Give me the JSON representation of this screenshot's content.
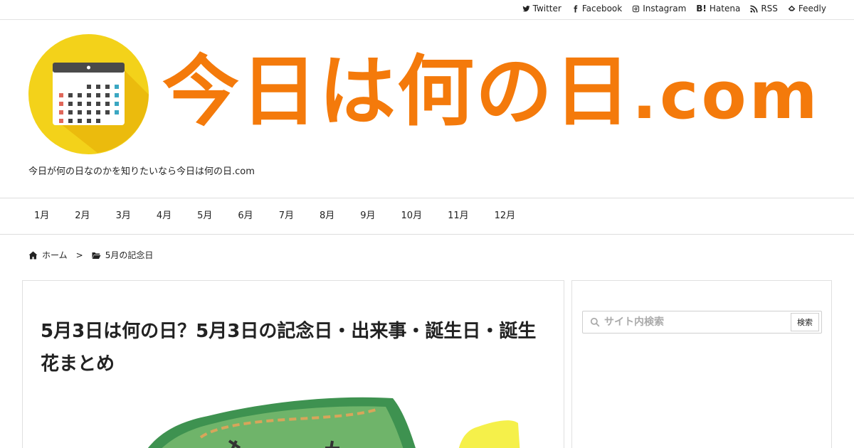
{
  "social": [
    {
      "label": "Twitter",
      "icon": "twitter-icon"
    },
    {
      "label": "Facebook",
      "icon": "facebook-icon"
    },
    {
      "label": "Instagram",
      "icon": "instagram-icon"
    },
    {
      "label": "Hatena",
      "icon": "hatena-icon"
    },
    {
      "label": "RSS",
      "icon": "rss-icon"
    },
    {
      "label": "Feedly",
      "icon": "feedly-icon"
    }
  ],
  "header": {
    "logo_text": "今日は何の日",
    "logo_suffix": ".com",
    "tagline": "今日が何の日なのかを知りたいなら今日は何の日.com",
    "brand_color": "#f47a0b"
  },
  "nav": [
    "1月",
    "2月",
    "3月",
    "4月",
    "5月",
    "6月",
    "7月",
    "8月",
    "9月",
    "10月",
    "11月",
    "12月"
  ],
  "breadcrumb": {
    "home": "ホーム",
    "separator": ">",
    "category": "5月の記念日"
  },
  "article": {
    "title": "5月3日は何の日？5月3日の記念日・出来事・誕生日・誕生花まとめ"
  },
  "sidebar": {
    "search_placeholder": "サイト内検索",
    "search_button": "検索"
  }
}
